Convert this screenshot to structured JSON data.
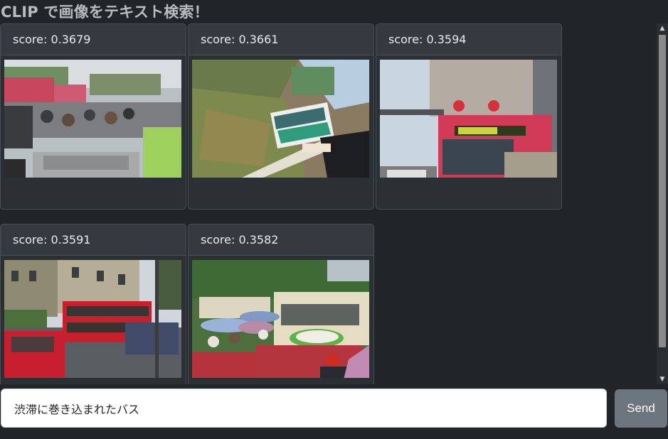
{
  "page": {
    "title": "CLIP で画像をテキスト検索！"
  },
  "results": [
    {
      "score": "score: 0.3679",
      "image": "Motorbike and car traffic jam on a city street"
    },
    {
      "score": "score: 0.3661",
      "image": "Tilted view of a bus on a grassy hillside road"
    },
    {
      "score": "score: 0.3594",
      "image": "Red bus with 70 speed signs at a bridge toll"
    },
    {
      "score": "score: 0.3591",
      "image": "Red double-decker bus on a residential street with parked cars"
    },
    {
      "score": "score: 0.3582",
      "image": "People with umbrellas between buses and cars"
    }
  ],
  "query": {
    "value": "渋滞に巻き込まれたバス",
    "placeholder": ""
  },
  "send": {
    "label": "Send"
  },
  "colors": {
    "background": "#212529",
    "card": "#2b3035",
    "card_header": "#343a40",
    "button": "#6c757d"
  }
}
